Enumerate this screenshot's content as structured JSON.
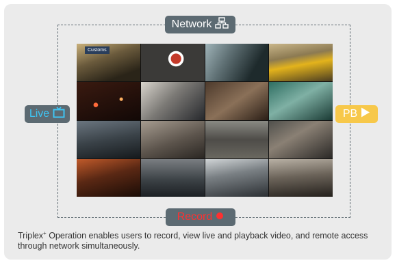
{
  "network": {
    "label": "Network",
    "icon": "network-icon"
  },
  "live": {
    "label": "Live",
    "icon": "tv-icon",
    "color": "#3ec5f4"
  },
  "playback": {
    "label": "PB",
    "icon": "play-icon"
  },
  "record": {
    "label": "Record",
    "icon": "record-dot-icon",
    "color": "#ff3030"
  },
  "camera_wall": {
    "rows": 4,
    "cols": 4,
    "sign_text": "Customs",
    "tiles": [
      "station-platform",
      "underground-sign",
      "subway-train",
      "taxi-street",
      "night-traffic",
      "office-worker",
      "meeting-table",
      "atm-keypad",
      "parking-lot",
      "conference-room",
      "street-crossing",
      "highway-cars",
      "city-street-night",
      "harbor-boats",
      "train-station",
      "pedestrian-walk"
    ]
  },
  "caption": {
    "brand": "Triplex",
    "superscript": "+",
    "text": " Operation enables users to record, view live and playback video, and remote access through network simultaneously."
  }
}
